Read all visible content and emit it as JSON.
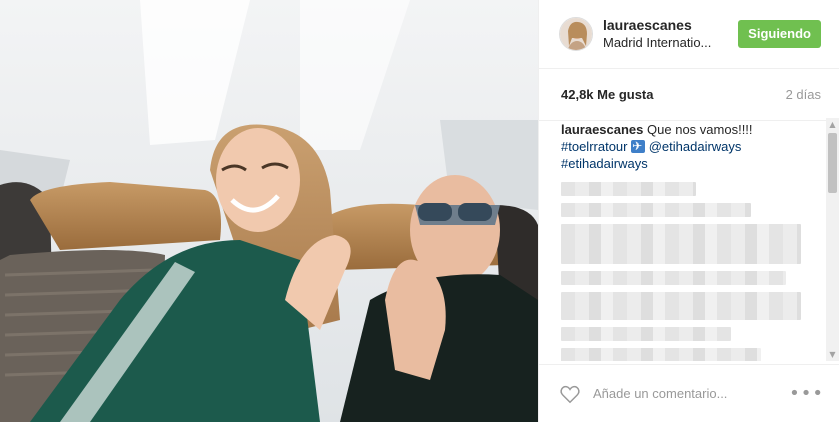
{
  "post": {
    "photo_alt": "",
    "header": {
      "username": "lauraescanes",
      "location": "Madrid Internatio...",
      "follow_label": "Siguiendo"
    },
    "meta": {
      "likes": "42,8k Me gusta",
      "time": "2 días"
    },
    "caption": {
      "username": "lauraescanes",
      "text": "Que nos vamos!!!!",
      "tag1": "#toelrratour",
      "mention": "@etihadairways",
      "tag2": "#etihadairways"
    },
    "footer": {
      "comment_placeholder": "Añade un comentario...",
      "more_label": "•••"
    },
    "colors": {
      "follow_green": "#70c050",
      "hashtag_blue": "#003569"
    }
  }
}
